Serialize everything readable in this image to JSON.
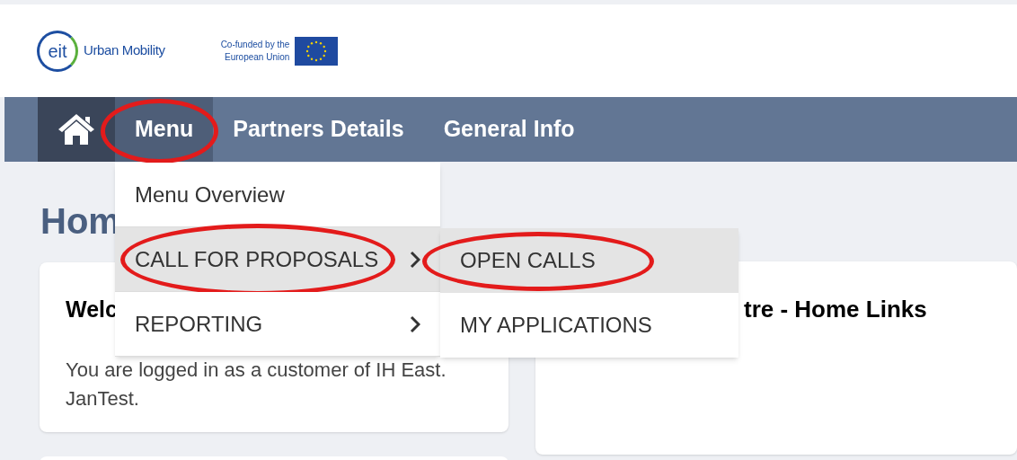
{
  "header": {
    "logo_mark": "eit",
    "logo_text": "Urban Mobility",
    "cofunded_lines": [
      "Co-funded by the",
      "European Union"
    ]
  },
  "nav": [
    {
      "kind": "home"
    },
    {
      "kind": "link",
      "label": "Menu",
      "selected": true,
      "circled": true
    },
    {
      "kind": "link",
      "label": "Partners Details",
      "selected": false,
      "circled": false
    },
    {
      "kind": "link",
      "label": "General Info",
      "selected": false,
      "circled": false
    }
  ],
  "dropdown": [
    {
      "label": "Menu Overview",
      "has_submenu": false,
      "selected": false,
      "circled": false
    },
    {
      "label": "CALL FOR PROPOSALS",
      "has_submenu": true,
      "selected": true,
      "circled": true
    },
    {
      "label": "REPORTING",
      "has_submenu": true,
      "selected": false,
      "circled": false
    }
  ],
  "submenu": [
    {
      "label": "OPEN CALLS",
      "selected": true,
      "circled": true
    },
    {
      "label": "MY APPLICATIONS",
      "selected": false,
      "circled": false
    }
  ],
  "page_title": "Hom",
  "cards": [
    {
      "title": "Welc",
      "text": "You are logged in as a customer of IH East. JanTest."
    },
    {
      "title": "tre - Home Links"
    }
  ]
}
